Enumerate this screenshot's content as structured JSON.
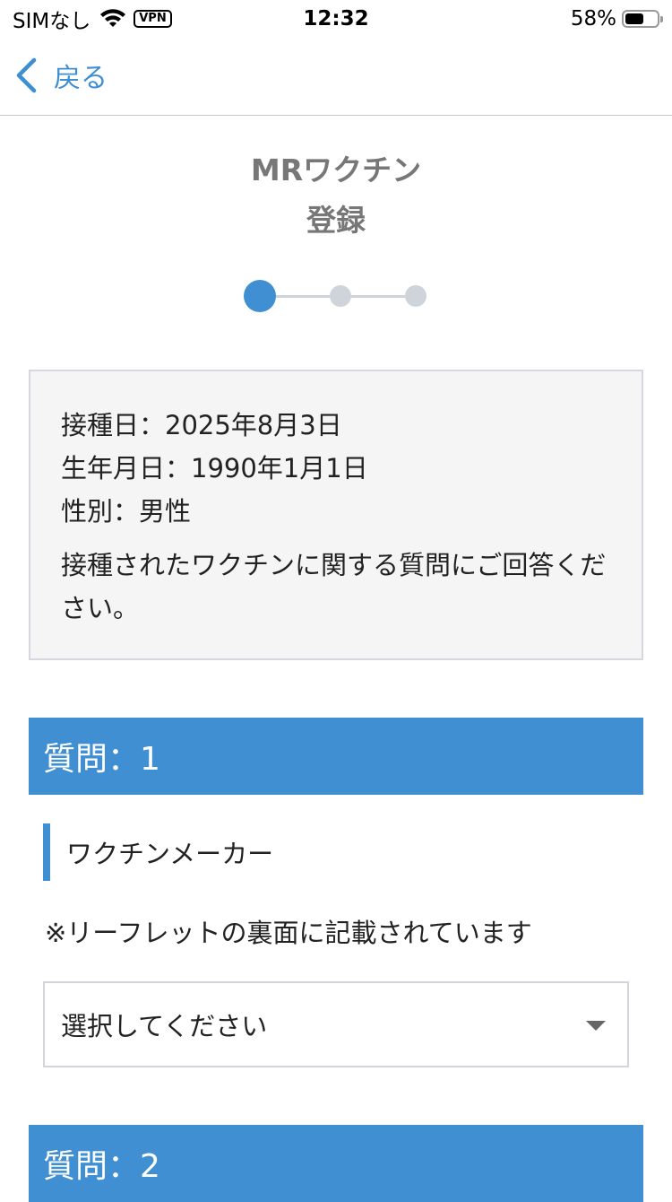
{
  "status_bar": {
    "carrier": "SIMなし",
    "vpn": "VPN",
    "time": "12:32",
    "battery": "58%",
    "battery_level": 0.58
  },
  "nav": {
    "back_label": "戻る"
  },
  "page": {
    "title_line1": "MRワクチン",
    "title_line2": "登録",
    "steps_total": 3,
    "current_step": 1,
    "accent_color": "#3f8fd2"
  },
  "info": {
    "vaccination_date": "接種日：2025年8月3日",
    "birth_date": "生年月日：1990年1月1日",
    "sex": "性別：男性",
    "message": "接種されたワクチンに関する質問にご回答ください。"
  },
  "questions": [
    {
      "header": "質問：1",
      "label": "ワクチンメーカー",
      "note": "※リーフレットの裏面に記載されています",
      "select_value": "選択してください"
    },
    {
      "header": "質問：2"
    }
  ]
}
